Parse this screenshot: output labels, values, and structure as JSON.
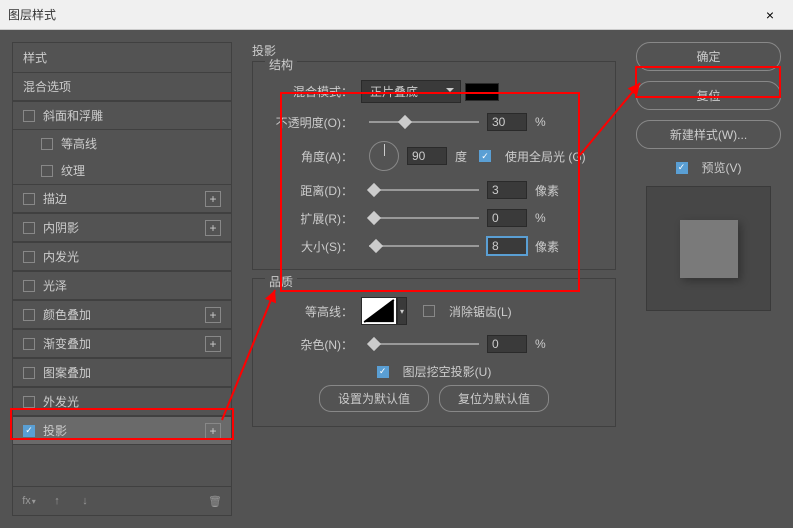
{
  "titlebar": {
    "title": "图层样式",
    "close": "×"
  },
  "left": {
    "header": "样式",
    "items": [
      {
        "label": "混合选项",
        "checkbox": false,
        "plus": false
      },
      {
        "label": "斜面和浮雕",
        "checkbox": true,
        "plus": false
      },
      {
        "label": "等高线",
        "checkbox": true,
        "plus": false,
        "indent": true
      },
      {
        "label": "纹理",
        "checkbox": true,
        "plus": false,
        "indent": true
      },
      {
        "label": "描边",
        "checkbox": true,
        "plus": true
      },
      {
        "label": "内阴影",
        "checkbox": true,
        "plus": true
      },
      {
        "label": "内发光",
        "checkbox": true,
        "plus": false
      },
      {
        "label": "光泽",
        "checkbox": true,
        "plus": false
      },
      {
        "label": "颜色叠加",
        "checkbox": true,
        "plus": true
      },
      {
        "label": "渐变叠加",
        "checkbox": true,
        "plus": true
      },
      {
        "label": "图案叠加",
        "checkbox": true,
        "plus": false
      },
      {
        "label": "外发光",
        "checkbox": true,
        "plus": false
      },
      {
        "label": "投影",
        "checkbox": true,
        "checked": true,
        "plus": true,
        "selected": true
      }
    ],
    "footer_fx": "fx"
  },
  "center": {
    "title": "投影",
    "structure": {
      "legend": "结构",
      "blend_mode_label": "混合模式：",
      "blend_mode_value": "正片叠底",
      "opacity_label": "不透明度(O)：",
      "opacity_value": "30",
      "opacity_unit": "%",
      "angle_label": "角度(A)：",
      "angle_value": "90",
      "angle_unit": "度",
      "global_light": "使用全局光 (G)",
      "distance_label": "距离(D)：",
      "distance_value": "3",
      "distance_unit": "像素",
      "spread_label": "扩展(R)：",
      "spread_value": "0",
      "spread_unit": "%",
      "size_label": "大小(S)：",
      "size_value": "8",
      "size_unit": "像素"
    },
    "quality": {
      "legend": "品质",
      "contour_label": "等高线：",
      "antialias": "消除锯齿(L)",
      "noise_label": "杂色(N)：",
      "noise_value": "0",
      "noise_unit": "%",
      "knockout": "图层挖空投影(U)"
    },
    "buttons": {
      "set_default": "设置为默认值",
      "reset_default": "复位为默认值"
    }
  },
  "right": {
    "ok": "确定",
    "reset": "复位",
    "new_style": "新建样式(W)...",
    "preview": "预览(V)"
  }
}
